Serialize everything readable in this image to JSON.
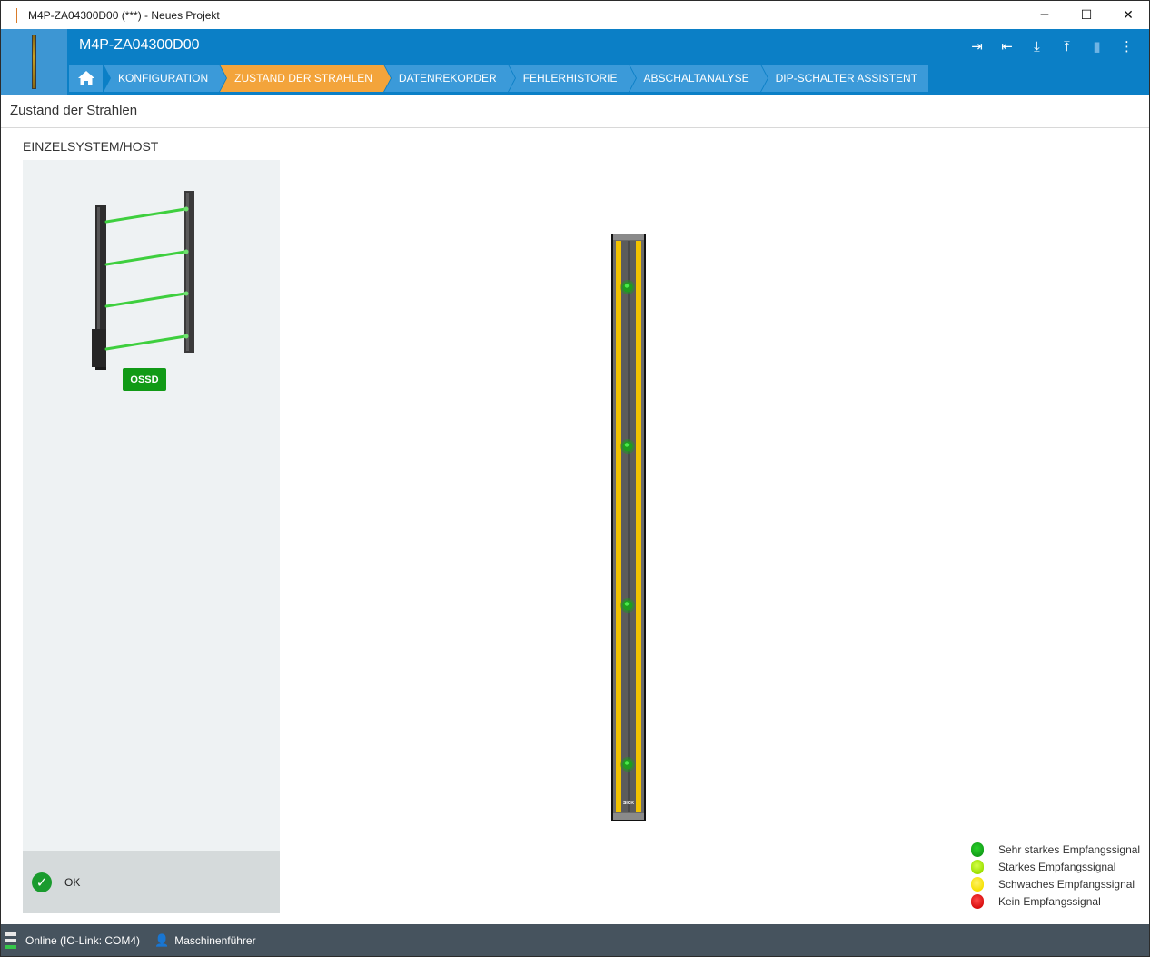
{
  "window": {
    "title": "M4P-ZA04300D00 (***) - Neues Projekt",
    "minimize": "─",
    "maximize": "☐",
    "close": "✕"
  },
  "header": {
    "device_title": "M4P-ZA04300D00",
    "tools": [
      {
        "icon": "login-icon",
        "glyph": "⇥"
      },
      {
        "icon": "logout-icon",
        "glyph": "⇤"
      },
      {
        "icon": "download-icon",
        "glyph": "⤓"
      },
      {
        "icon": "upload-icon",
        "glyph": "⤒"
      },
      {
        "icon": "device-icon",
        "glyph": "▮"
      },
      {
        "icon": "more-icon",
        "glyph": "⋮"
      }
    ]
  },
  "nav": {
    "home_icon": "home-icon",
    "tabs": [
      {
        "label": "KONFIGURATION",
        "active": false
      },
      {
        "label": "ZUSTAND DER STRAHLEN",
        "active": true
      },
      {
        "label": "DATENREKORDER",
        "active": false
      },
      {
        "label": "FEHLERHISTORIE",
        "active": false
      },
      {
        "label": "ABSCHALTANALYSE",
        "active": false
      },
      {
        "label": "DIP-SCHALTER ASSISTENT",
        "active": false
      }
    ]
  },
  "page": {
    "title": "Zustand der Strahlen",
    "section_title": "EINZELSYSTEM/HOST",
    "ossd_label": "OSSD",
    "status_text": "OK",
    "device_brand": "SICK"
  },
  "beams": [
    {
      "state": "strong_very",
      "color": "#1f9d1f"
    },
    {
      "state": "strong_very",
      "color": "#1f9d1f"
    },
    {
      "state": "strong_very",
      "color": "#1f9d1f"
    },
    {
      "state": "strong_very",
      "color": "#1f9d1f"
    }
  ],
  "legend": [
    {
      "label": "Sehr starkes Empfangssignal",
      "color": "#139e1a"
    },
    {
      "label": "Starkes Empfangssignal",
      "color": "#9be000"
    },
    {
      "label": "Schwaches Empfangssignal",
      "color": "#f5e000"
    },
    {
      "label": "Kein Empfangssignal",
      "color": "#d80f0f"
    }
  ],
  "statusbar": {
    "connection": "Online (IO-Link: COM4)",
    "user": "Maschinenführer"
  },
  "colors": {
    "header_blue": "#0b7fc6",
    "tab_blue": "#3b9ad9",
    "tab_active": "#f3a43b",
    "ok_green": "#1a9b2e",
    "beam_green": "#2ecc40"
  }
}
